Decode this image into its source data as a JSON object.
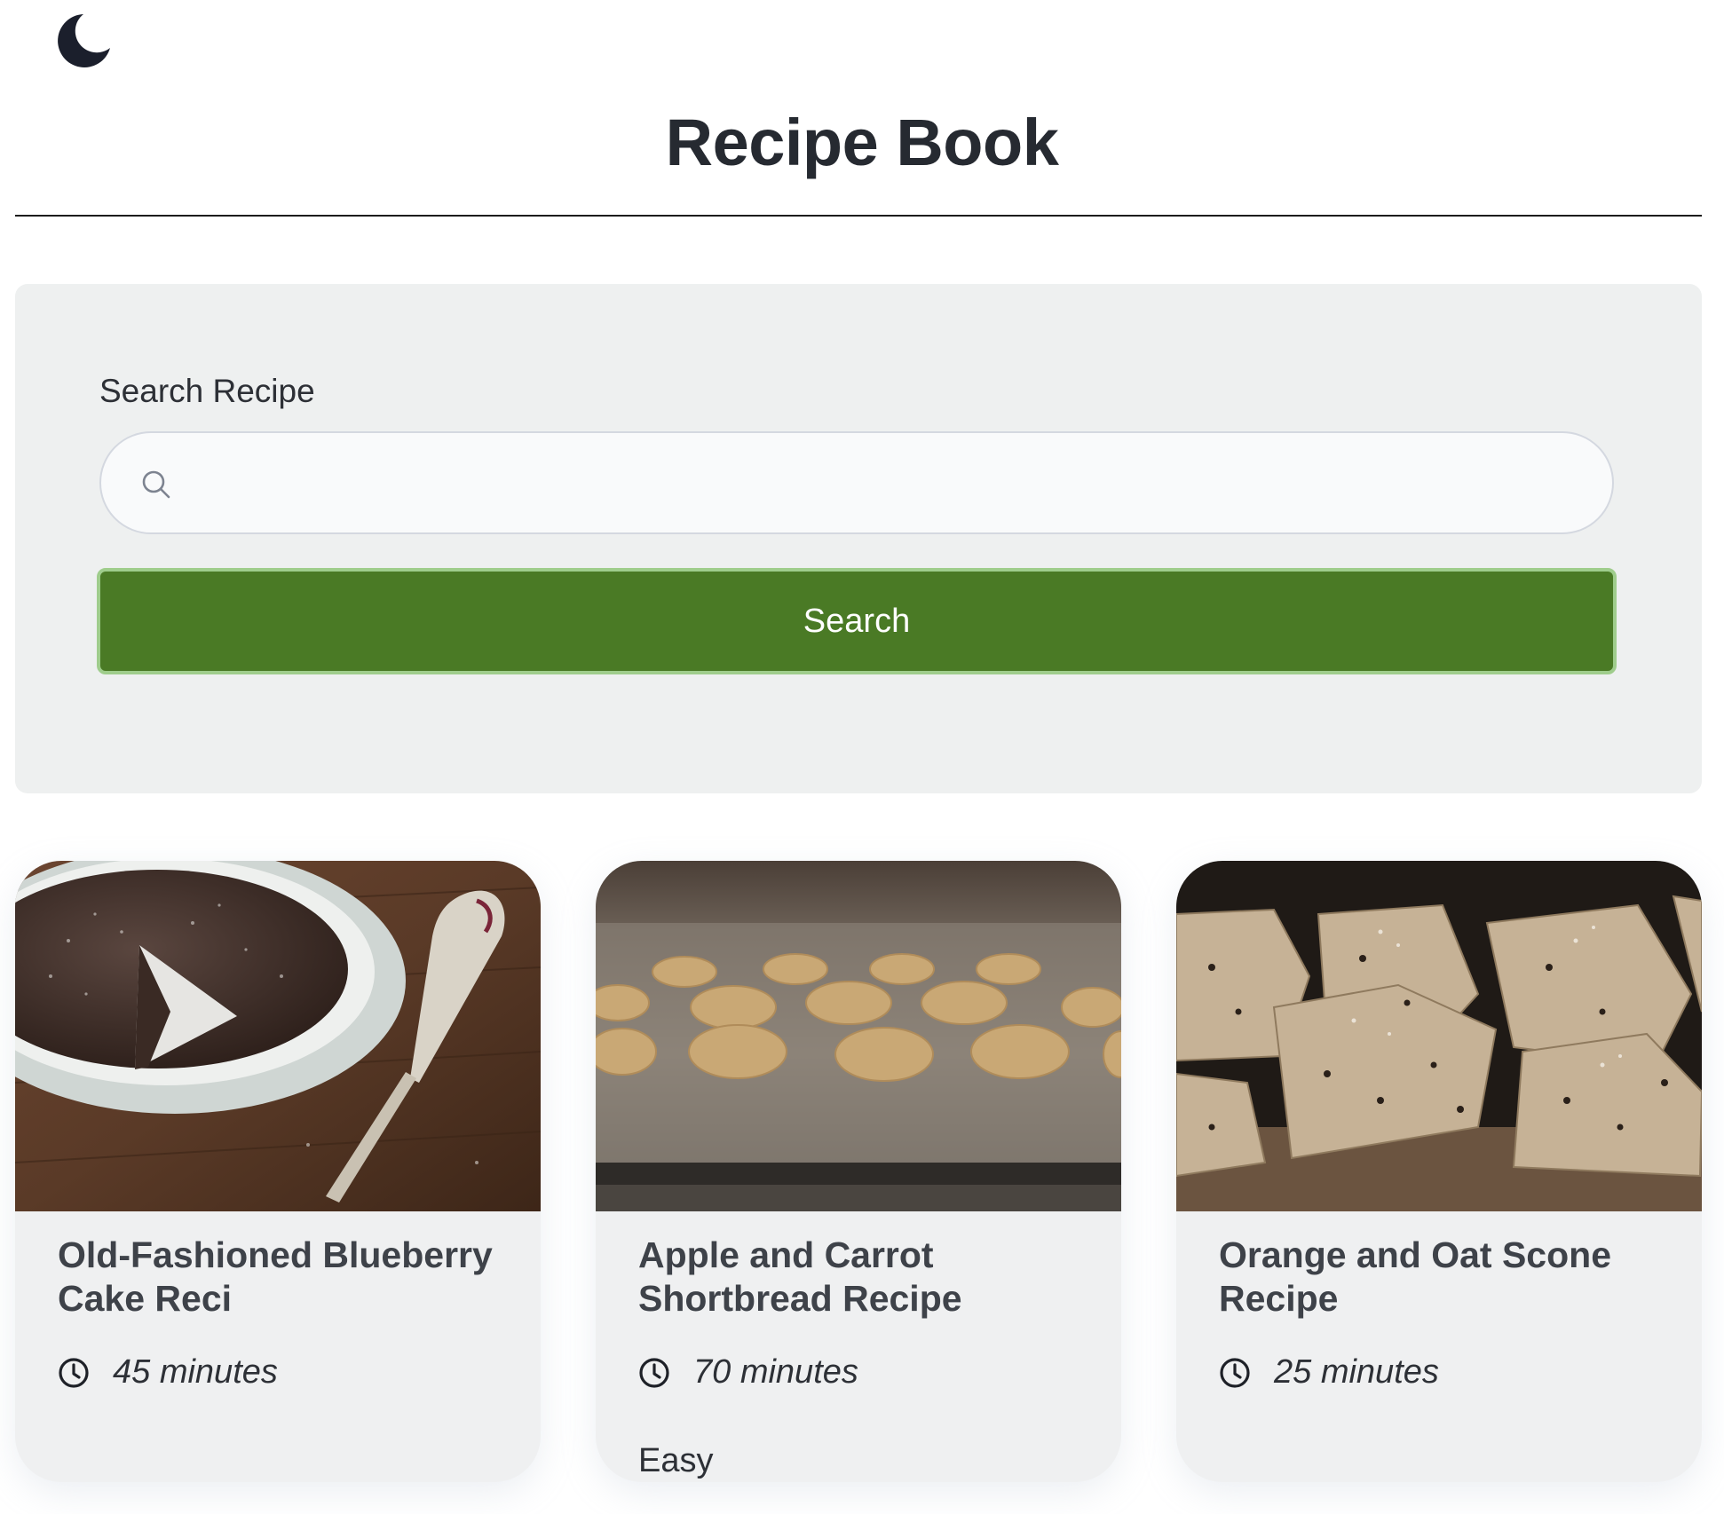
{
  "header": {
    "theme_toggle_icon": "moon-icon",
    "title": "Recipe Book"
  },
  "search": {
    "label": "Search Recipe",
    "icon": "search-icon",
    "value": "",
    "placeholder": "",
    "button_label": "Search",
    "button_color": "#4a7a25"
  },
  "recipes": [
    {
      "title": "Old-Fashioned Blueberry Cake Reci",
      "time_icon": "clock-icon",
      "time": "45 minutes",
      "difficulty": ""
    },
    {
      "title": "Apple and Carrot Shortbread Recipe",
      "time_icon": "clock-icon",
      "time": "70 minutes",
      "difficulty": "Easy"
    },
    {
      "title": "Orange and Oat Scone Recipe",
      "time_icon": "clock-icon",
      "time": "25 minutes",
      "difficulty": ""
    }
  ]
}
